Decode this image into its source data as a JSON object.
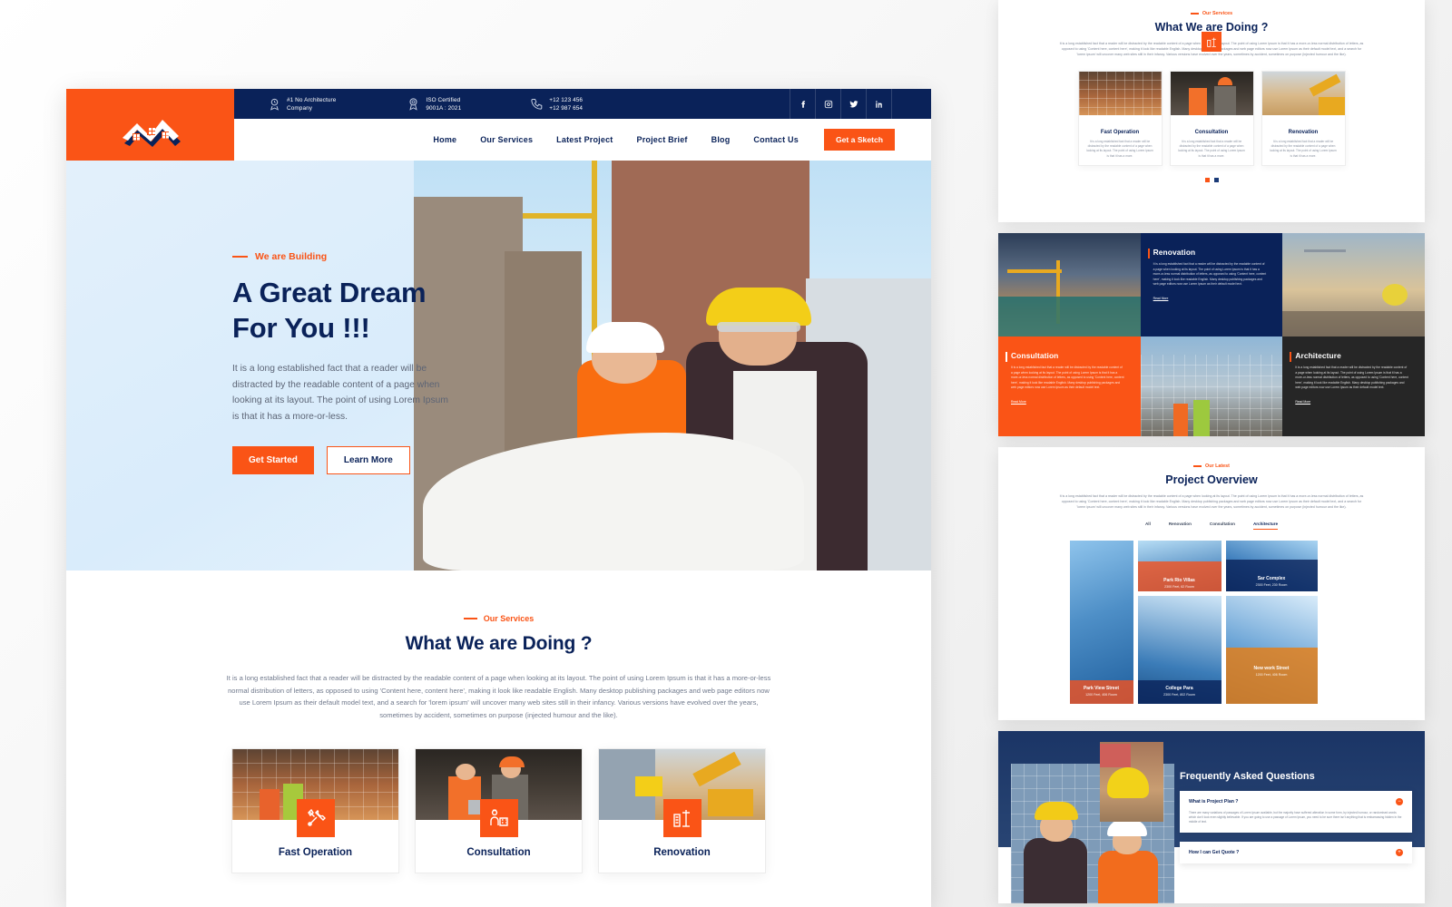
{
  "topbar": {
    "info": [
      {
        "icon": "award-icon",
        "line1": "#1 No Architecture",
        "line2": "Company"
      },
      {
        "icon": "certificate-icon",
        "line1": "ISO Certified",
        "line2": "9001A : 2021"
      },
      {
        "icon": "phone-icon",
        "line1": "+12 123 456",
        "line2": "+12 987 654"
      }
    ],
    "socials": [
      "facebook-icon",
      "instagram-icon",
      "twitter-icon",
      "linkedin-icon"
    ]
  },
  "nav": {
    "items": [
      "Home",
      "Our Services",
      "Latest Project",
      "Project Brief",
      "Blog",
      "Contact Us"
    ],
    "cta": "Get a Sketch"
  },
  "hero": {
    "eyebrow": "We are Building",
    "title_line1": "A Great Dream",
    "title_line2": "For You !!!",
    "paragraph": "It is a long established fact that a reader will be distracted by the readable content of a page when looking at its layout. The point of using Lorem Ipsum is that it has a more-or-less.",
    "btn_primary": "Get Started",
    "btn_secondary": "Learn More"
  },
  "services": {
    "eyebrow": "Our Services",
    "title": "What We are Doing ?",
    "paragraph": "It is a long established fact that a reader will be distracted by the readable content of a page when looking at its layout. The point of using Lorem Ipsum is that it has a more-or-less normal distribution of letters, as opposed to using 'Content here, content here', making it look like readable English. Many desktop publishing packages and web page editors now use Lorem Ipsum as their default model text, and a search for 'lorem ipsum' will uncover many web sites still in their infancy. Various versions have evolved over the years, sometimes by accident, sometimes on purpose (injected humour and the like).",
    "cards": [
      {
        "title": "Fast Operation",
        "icon": "tools-icon",
        "body": "It is a long established fact that a reader will be distracted by the readable content of a page when looking at its layout. The point of using Lorem Ipsum is that it has a more."
      },
      {
        "title": "Consultation",
        "icon": "worker-consult-icon",
        "body": "It is a long established fact that a reader will be distracted by the readable content of a page when looking at its layout. The point of using Lorem Ipsum is that it has a more."
      },
      {
        "title": "Renovation",
        "icon": "crane-icon",
        "body": "It is a long established fact that a reader will be distracted by the readable content of a page when looking at its layout. The point of using Lorem Ipsum is that it has a more."
      }
    ]
  },
  "feature_tiles": [
    {
      "title": "Renovation",
      "theme": "navy",
      "body": "It is a long established fact that a reader will be distracted by the readable content of a page when looking at its layout. The point of using Lorem Ipsum is that it has a more-or-less normal distribution of letters, as opposed to using 'Content here, content here', making it look like readable English. Many desktop publishing packages and web page editors now use Lorem Ipsum as their default model text.",
      "link": "Read More"
    },
    {
      "title": "Consultation",
      "theme": "orange",
      "body": "It is a long established fact that a reader will be distracted by the readable content of a page when looking at its layout. The point of using Lorem Ipsum is that it has a more-or-less normal distribution of letters, as opposed to using 'Content here, content here', making it look like readable English. Many desktop publishing packages and web page editors now use Lorem Ipsum as their default model text.",
      "link": "Read More"
    },
    {
      "title": "Architecture",
      "theme": "dark",
      "body": "It is a long established fact that a reader will be distracted by the readable content of a page when looking at its layout. The point of using Lorem Ipsum is that it has a more-or-less normal distribution of letters, as opposed to using 'Content here, content here', making it look like readable English. Many desktop publishing packages and web page editors now use Lorem Ipsum as their default model text.",
      "link": "Read More"
    }
  ],
  "projects": {
    "eyebrow": "Our Latest",
    "title": "Project Overview",
    "paragraph": "It is a long established fact that a reader will be distracted by the readable content of a page when looking at its layout. The point of using Lorem Ipsum is that it has a more-or-less normal distribution of letters, as opposed to using 'Content here, content here', making it look like readable English. Many desktop publishing packages and web page editors now use Lorem Ipsum as their default model text, and a search for 'lorem ipsum' will uncover many web sites still in their infancy. Various versions have evolved over the years, sometimes by accident, sometimes on purpose (injected humour and the like).",
    "tabs": [
      "All",
      "Renovation",
      "Consultation",
      "Architecture"
    ],
    "active_tab": "Architecture",
    "items": [
      {
        "name": "Park View Street",
        "meta": "1200 Feet, 406 Room",
        "overlay": "#F4511E"
      },
      {
        "name": "Park Rio Villas",
        "meta": "2300 Feet, 62 Room",
        "overlay": "#F4511E"
      },
      {
        "name": "Sar Complex",
        "meta": "2300 Feet, 230 Room",
        "overlay": "#0A2259"
      },
      {
        "name": "College Para",
        "meta": "2300 Feet, 802 Room",
        "overlay": "#0A2259"
      },
      {
        "name": "New work Street",
        "meta": "1200 Feet, 406 Room",
        "overlay": "#E67E14"
      }
    ]
  },
  "faq": {
    "title": "Frequently Asked Questions",
    "items": [
      {
        "q": "What is Project Plan ?",
        "sign": "−",
        "open": true,
        "a": "There are many variations of passages of Lorem Ipsum available, but the majority have suffered alteration in some form, by injected humour, or randomised words which don't look even slightly believable. If you are going to use a passage of Lorem Ipsum, you need to be sure there isn't anything that is embarrassing hidden in the middle of text."
      },
      {
        "q": "How I can Get Quote ?",
        "sign": "+",
        "open": false,
        "a": ""
      }
    ]
  },
  "carousel": {
    "dots": 2,
    "active": 0
  },
  "colors": {
    "orange": "#FA5416",
    "navy": "#0A2259",
    "dark": "#262626"
  }
}
